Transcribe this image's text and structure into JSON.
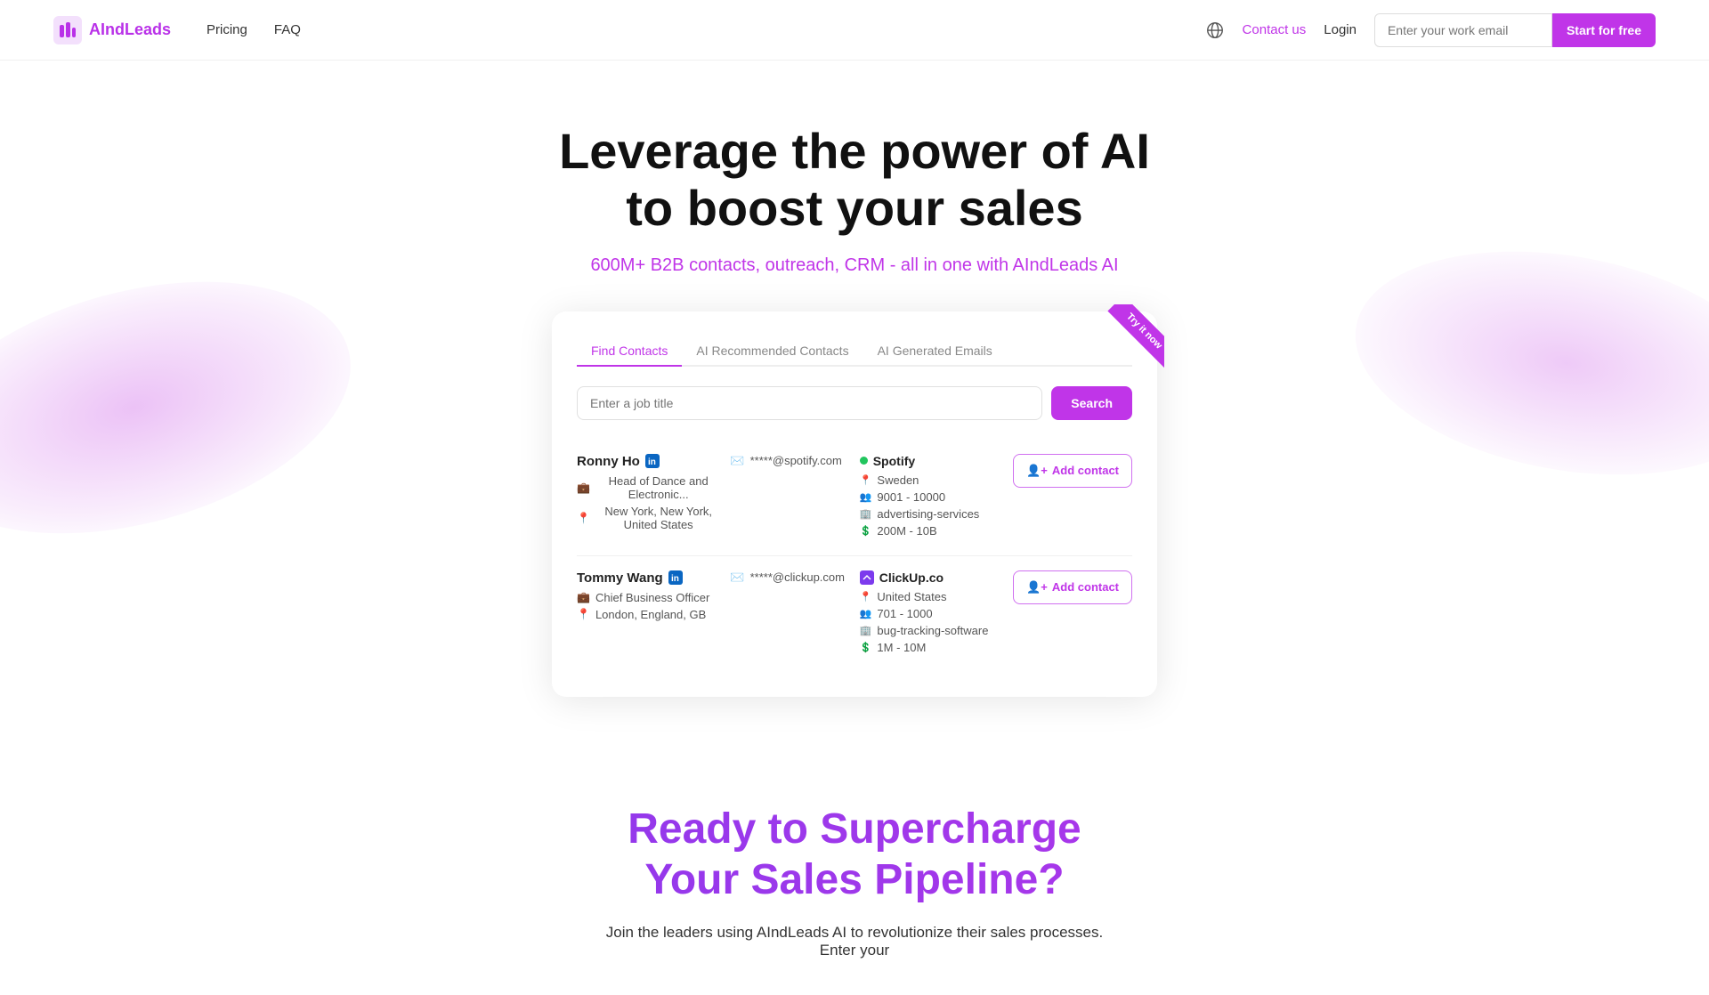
{
  "nav": {
    "logo_text": "AIndLeads",
    "links": [
      {
        "label": "Pricing",
        "id": "pricing"
      },
      {
        "label": "FAQ",
        "id": "faq"
      }
    ],
    "contact_label": "Contact us",
    "login_label": "Login",
    "email_placeholder": "Enter your work email",
    "start_btn": "Start for free"
  },
  "hero": {
    "headline_line1": "Leverage the power of AI",
    "headline_line2": "to boost your sales",
    "subtext": "600M+ B2B contacts, outreach, CRM - all in one with AIndLeads AI"
  },
  "demo": {
    "try_ribbon": "Try it now",
    "tabs": [
      {
        "label": "Find Contacts",
        "active": true
      },
      {
        "label": "AI Recommended Contacts",
        "active": false
      },
      {
        "label": "AI Generated Emails",
        "active": false
      }
    ],
    "search_placeholder": "Enter a job title",
    "search_btn": "Search",
    "contacts": [
      {
        "name": "Ronny Ho",
        "title": "Head of Dance and Electronic...",
        "location": "New York, New York, United States",
        "email": "*****@spotify.com",
        "company_name": "Spotify",
        "company_green": true,
        "company_location": "Sweden",
        "company_employees": "9001 - 10000",
        "company_industry": "advertising-services",
        "company_revenue": "200M - 10B",
        "add_label": "Add contact"
      },
      {
        "name": "Tommy Wang",
        "title": "Chief Business Officer",
        "location": "London, England, GB",
        "email": "*****@clickup.com",
        "company_name": "ClickUp.co",
        "company_green": false,
        "company_location": "United States",
        "company_employees": "701 - 1000",
        "company_industry": "bug-tracking-software",
        "company_revenue": "1M - 10M",
        "add_label": "Add contact"
      }
    ]
  },
  "bottom": {
    "title_line1": "Ready to Supercharge",
    "title_line2": "Your Sales Pipeline?",
    "sub": "Join the leaders using AIndLeads AI to revolutionize their sales processes. Enter your"
  }
}
